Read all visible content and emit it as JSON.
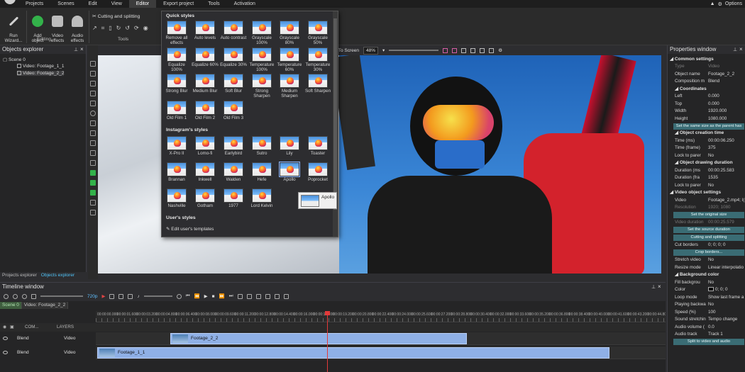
{
  "menu": {
    "items": [
      "Projects",
      "Scenes",
      "Edit",
      "View",
      "Editor",
      "Export project",
      "Tools",
      "Activation"
    ],
    "active": "Editor",
    "options_label": "Options"
  },
  "ribbon": {
    "run_wizard": "Run\nWizard...",
    "add_object": "Add\nobject",
    "video_effects": "Video\neffects",
    "audio_effects": "Audio\neffects",
    "editing_label": "Editing",
    "cutting_splitting": "Cutting and splitting",
    "tools_label": "Tools"
  },
  "objects_explorer": {
    "title": "Objects explorer",
    "scene": "Scene 0",
    "items": [
      "Video: Footage_1_1",
      "Video: Footage_2_2"
    ],
    "tabs": [
      "Projects explorer",
      "Objects explorer"
    ]
  },
  "canvas_toolbar": {
    "zoom_to_screen": "om To Screen",
    "zoom_value": "48%"
  },
  "quick_styles": {
    "section_quick": "Quick styles",
    "quick": [
      "Remove all effects",
      "Auto levels",
      "Auto contrast",
      "Grayscale 100%",
      "Grayscale 80%",
      "Grayscale 50%",
      "Equalize 100%",
      "Equalize 60%",
      "Equalize 30%",
      "Temperature 100%",
      "Temperature 60%",
      "Temperature 30%",
      "Strong Blur",
      "Medium Blur",
      "Soft Blur",
      "Strong Sharpen",
      "Medium Sharpen",
      "Soft Sharpen",
      "Old Film 1",
      "Old Film 2",
      "Old Film 3"
    ],
    "section_instagram": "Instagram's styles",
    "instagram": [
      "X-Pro II",
      "Lomo-fi",
      "Earlybird",
      "Sutro",
      "Lily",
      "Toaster",
      "Brannan",
      "Inkwell",
      "Walden",
      "Hefe",
      "Apollo",
      "Poprocket",
      "Nashville",
      "Gotham",
      "1977",
      "Lord Kelvin"
    ],
    "selected": "Apollo",
    "tooltip": "Apollo",
    "section_user": "User's styles",
    "edit_templates": "Edit user's templates"
  },
  "properties": {
    "title": "Properties window",
    "sec_common": "Common settings",
    "type_k": "Type",
    "type_v": "Video",
    "name_k": "Object name",
    "name_v": "Footage_2_2",
    "comp_k": "Composition m",
    "comp_v": "Blend",
    "sec_coords": "Coordinates",
    "left_k": "Left",
    "left_v": "0.000",
    "top_k": "Top",
    "top_v": "0.000",
    "width_k": "Width",
    "width_v": "1920.000",
    "height_k": "Height",
    "height_v": "1080.000",
    "btn_same_size": "Set the same size as the parent has",
    "sec_creation": "Object creation time",
    "time_ms_k": "Time (ms)",
    "time_ms_v": "00:00:06.250",
    "time_fr_k": "Time (frame)",
    "time_fr_v": "375",
    "lock1_k": "Lock to parer",
    "lock1_v": "No",
    "sec_duration": "Object drawing duration",
    "dur_ms_k": "Duration (ms",
    "dur_ms_v": "00:00:25.583",
    "dur_fr_k": "Duration (fra",
    "dur_fr_v": "1535",
    "lock2_k": "Lock to parer",
    "lock2_v": "No",
    "sec_video": "Video object settings",
    "video_k": "Video",
    "video_v": "Footage_2.mp4; I(",
    "res_k": "Resolution",
    "res_v": "1920; 1080",
    "btn_original_size": "Set the original size",
    "vdur_k": "Video duration",
    "vdur_v": "00:00:25.579",
    "btn_source_duration": "Set the source duration",
    "btn_cutting": "Cutting and splitting",
    "cut_k": "Cut borders",
    "cut_v": "0; 0; 0; 0",
    "btn_crop": "Crop borders...",
    "stretch_k": "Stretch video",
    "stretch_v": "No",
    "resize_k": "Resize mode",
    "resize_v": "Linear interpolatio",
    "sec_bg": "Background color",
    "fill_k": "Fill backgrou",
    "fill_v": "No",
    "color_k": "Color",
    "color_v": "0; 0; 0",
    "loop_k": "Loop mode",
    "loop_v": "Show last frame a",
    "back_k": "Playing backwa",
    "back_v": "No",
    "speed_k": "Speed (%)",
    "speed_v": "100",
    "stretch_snd_k": "Sound stretchin",
    "stretch_snd_v": "Tempo change",
    "vol_k": "Audio volume (",
    "vol_v": "0.0",
    "track_k": "Audio track",
    "track_v": "Track 1",
    "btn_split": "Split to video and audio"
  },
  "timeline": {
    "title": "Timeline window",
    "resolution": "720p",
    "tabs": [
      "Scene 0",
      "Video: Footage_2_2"
    ],
    "ruler": [
      "00:00:00.000",
      "00:00:01.600",
      "00:00:03.200",
      "00:00:04.800",
      "00:00:06.400",
      "00:00:08.000",
      "00:00:09.600",
      "00:00:11.200",
      "00:00:12.800",
      "00:00:14.400",
      "00:00:16.000",
      "00:00:17.600",
      "00:00:19.200",
      "00:00:20.800",
      "00:00:22.400",
      "00:00:24.000",
      "00:00:25.600",
      "00:00:27.200",
      "00:00:28.800",
      "00:00:30.400",
      "00:00:32.000",
      "00:00:33.600",
      "00:00:35.200",
      "00:00:36.800",
      "00:00:38.400",
      "00:00:40.000",
      "00:00:41.600",
      "00:00:43.200",
      "00:00:44.800",
      "00:00:46.400"
    ],
    "layers_label": "LAYERS",
    "com_label": "COM...",
    "tracks": [
      {
        "blend": "Blend",
        "type": "Video",
        "clip": "Footage_2_2"
      },
      {
        "blend": "Blend",
        "type": "Video",
        "clip": "Footage_1_1"
      }
    ]
  }
}
